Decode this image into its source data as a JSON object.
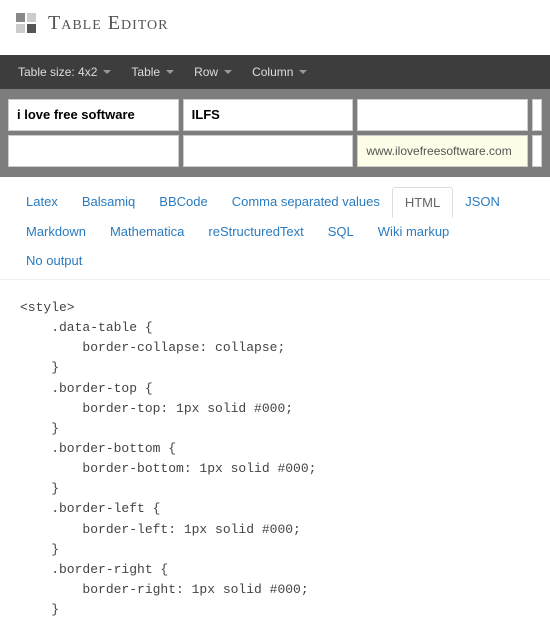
{
  "header": {
    "title": "Table Editor"
  },
  "toolbar": {
    "size_label": "Table size: 4x2",
    "menus": [
      "Table",
      "Row",
      "Column"
    ]
  },
  "table": {
    "rows": [
      [
        "i love free software",
        "ILFS",
        "",
        ""
      ],
      [
        "",
        "",
        "www.ilovefreesoftware.com",
        ""
      ]
    ]
  },
  "tabs": {
    "items": [
      "Latex",
      "Balsamiq",
      "BBCode",
      "Comma separated values",
      "HTML",
      "JSON",
      "Markdown",
      "Mathematica",
      "reStructuredText",
      "SQL",
      "Wiki markup",
      "No output"
    ],
    "active": "HTML"
  },
  "output": "<style>\n    .data-table {\n        border-collapse: collapse;\n    }\n    .border-top {\n        border-top: 1px solid #000;\n    }\n    .border-bottom {\n        border-bottom: 1px solid #000;\n    }\n    .border-left {\n        border-left: 1px solid #000;\n    }\n    .border-right {\n        border-right: 1px solid #000;\n    }"
}
